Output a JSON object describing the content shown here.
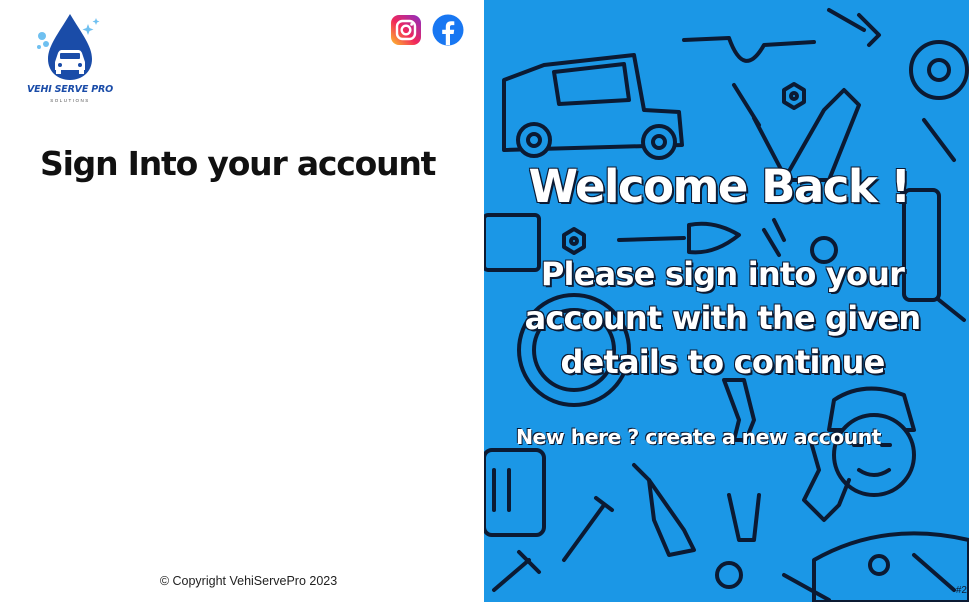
{
  "brand": {
    "name": "VEHI SERVE PRO",
    "tagline": "SOLUTIONS",
    "primary_color": "#1a4ca8",
    "panel_color": "#1b97e6"
  },
  "social": {
    "instagram_icon": "instagram-icon",
    "facebook_icon": "facebook-icon"
  },
  "signin": {
    "title": "Sign Into your account"
  },
  "welcome": {
    "heading": "Welcome Back !",
    "message_lines": [
      "Please sign into your",
      "account with the given",
      "details to continue"
    ],
    "new_account_link": "New here ? create a new account"
  },
  "footer": {
    "copyright": "© Copyright VehiServePro 2023"
  },
  "corner_tag": "#2"
}
